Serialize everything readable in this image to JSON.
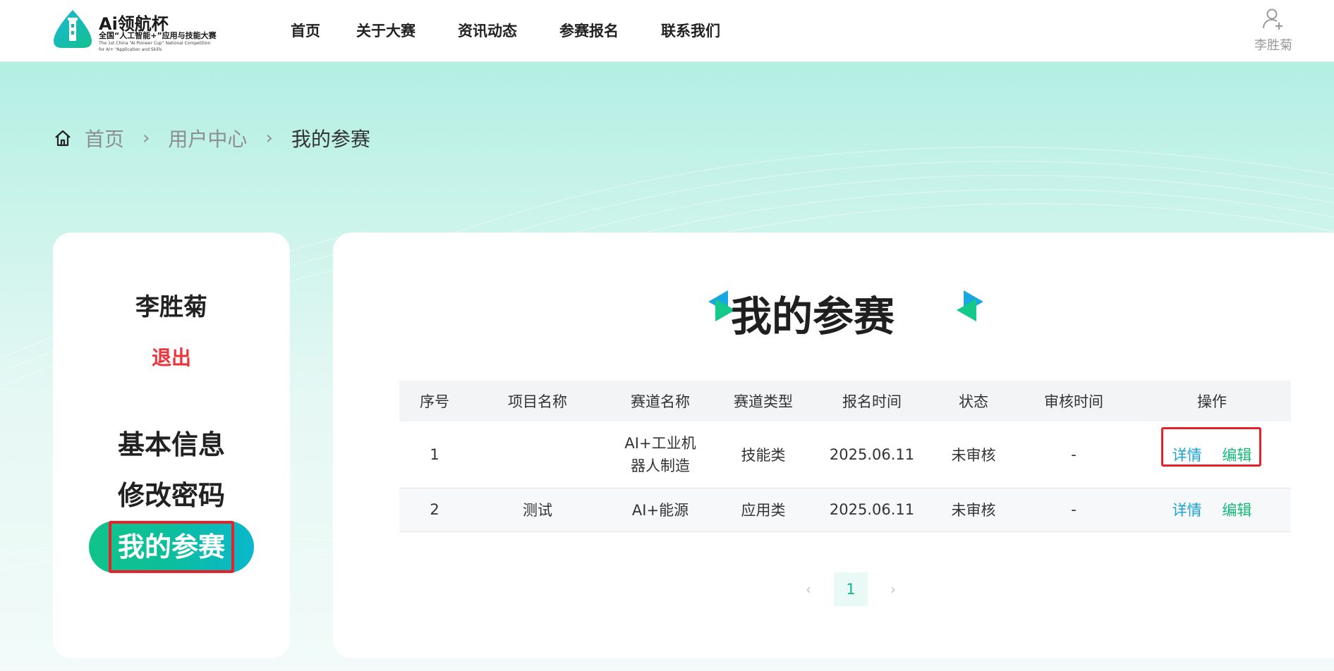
{
  "header": {
    "logo_title": "Ai领航杯",
    "logo_subtitle": "全国“人工智能+”应用与技能大赛",
    "logo_en_line1": "The 1st China “AI Pioneer Cup” National Competition",
    "logo_en_line2": "for AI+ “Application and Skills",
    "nav": [
      "首页",
      "关于大赛",
      "资讯动态",
      "参赛报名",
      "联系我们"
    ],
    "user_name": "李胜菊"
  },
  "breadcrumb": {
    "items": [
      "首页",
      "用户中心"
    ],
    "current": "我的参赛"
  },
  "sidebar": {
    "name": "李胜菊",
    "logout": "退出",
    "menu": [
      "基本信息",
      "修改密码",
      "我的参赛"
    ],
    "active_index": 2
  },
  "main": {
    "title": "我的参赛",
    "columns": [
      "序号",
      "项目名称",
      "赛道名称",
      "赛道类型",
      "报名时间",
      "状态",
      "审核时间",
      "操作"
    ],
    "rows": [
      {
        "index": "1",
        "project": "",
        "track": "AI+工业机器人制造",
        "track_type": "技能类",
        "time": "2025.06.11",
        "status": "未审核",
        "audit_time": "-",
        "detail": "详情",
        "edit": "编辑"
      },
      {
        "index": "2",
        "project": "测试",
        "track": "AI+能源",
        "track_type": "应用类",
        "time": "2025.06.11",
        "status": "未审核",
        "audit_time": "-",
        "detail": "详情",
        "edit": "编辑"
      }
    ],
    "pagination": {
      "prev": "‹",
      "current": "1",
      "next": "›"
    }
  },
  "colors": {
    "accent_green": "#16b87a",
    "accent_blue": "#19a2d4",
    "logout_red": "#f0333a",
    "highlight_red": "#e8202a"
  }
}
